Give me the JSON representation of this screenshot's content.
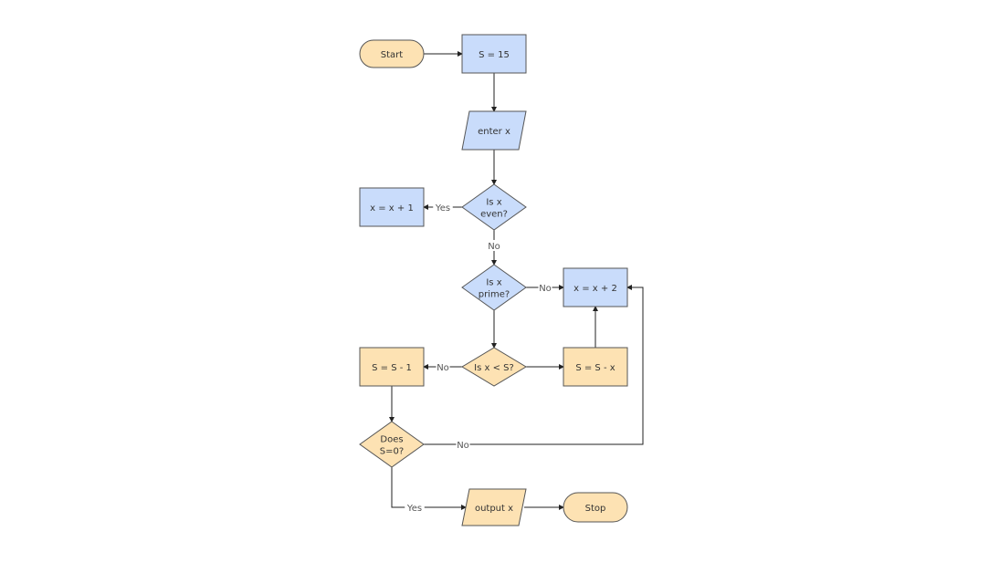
{
  "colors": {
    "blue_fill": "#c9dcfb",
    "orange_fill": "#fde2b3",
    "stroke": "#555555",
    "edge": "#222222"
  },
  "nodes": {
    "start": {
      "label": "Start",
      "shape": "terminator",
      "color": "orange"
    },
    "init_s": {
      "label": "S = 15",
      "shape": "process",
      "color": "blue"
    },
    "enter_x": {
      "label": "enter x",
      "shape": "io",
      "color": "blue"
    },
    "is_even": {
      "label": [
        "Is x",
        "even?"
      ],
      "shape": "decision",
      "color": "blue"
    },
    "x_plus_1": {
      "label": "x = x + 1",
      "shape": "process",
      "color": "blue"
    },
    "is_prime": {
      "label": [
        "Is x",
        "prime?"
      ],
      "shape": "decision",
      "color": "blue"
    },
    "x_plus_2": {
      "label": "x = x + 2",
      "shape": "process",
      "color": "blue"
    },
    "x_lt_s": {
      "label": "Is x < S?",
      "shape": "decision",
      "color": "orange"
    },
    "s_minus_x": {
      "label": "S = S - x",
      "shape": "process",
      "color": "orange"
    },
    "s_minus_1": {
      "label": "S = S - 1",
      "shape": "process",
      "color": "orange"
    },
    "s_zero": {
      "label": [
        "Does",
        "S=0?"
      ],
      "shape": "decision",
      "color": "orange"
    },
    "output_x": {
      "label": "output x",
      "shape": "io",
      "color": "orange"
    },
    "stop": {
      "label": "Stop",
      "shape": "terminator",
      "color": "orange"
    }
  },
  "edges": [
    {
      "from": "start",
      "to": "init_s",
      "label": ""
    },
    {
      "from": "init_s",
      "to": "enter_x",
      "label": ""
    },
    {
      "from": "enter_x",
      "to": "is_even",
      "label": ""
    },
    {
      "from": "is_even",
      "to": "x_plus_1",
      "label": "Yes"
    },
    {
      "from": "is_even",
      "to": "is_prime",
      "label": "No"
    },
    {
      "from": "is_prime",
      "to": "x_plus_2",
      "label": "No"
    },
    {
      "from": "is_prime",
      "to": "x_lt_s",
      "label": ""
    },
    {
      "from": "x_lt_s",
      "to": "s_minus_1",
      "label": "No"
    },
    {
      "from": "x_lt_s",
      "to": "s_minus_x",
      "label": ""
    },
    {
      "from": "s_minus_x",
      "to": "x_plus_2",
      "label": ""
    },
    {
      "from": "s_minus_1",
      "to": "s_zero",
      "label": ""
    },
    {
      "from": "s_zero",
      "to": "x_plus_2",
      "label": "No"
    },
    {
      "from": "s_zero",
      "to": "output_x",
      "label": "Yes"
    },
    {
      "from": "output_x",
      "to": "stop",
      "label": ""
    }
  ]
}
